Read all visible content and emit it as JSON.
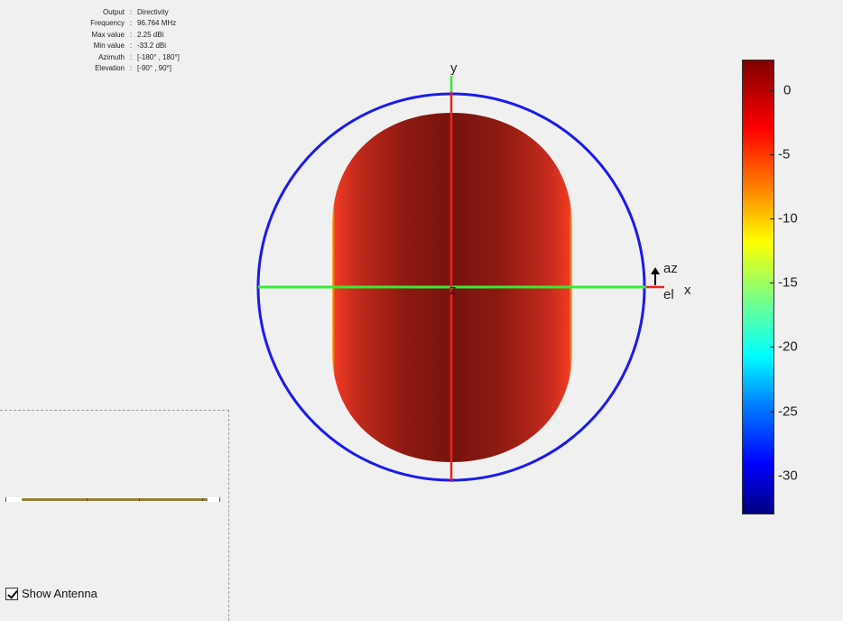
{
  "info": {
    "rows": [
      {
        "label": "Output",
        "value": "Directivity"
      },
      {
        "label": "Frequency",
        "value": "96.764 MHz"
      },
      {
        "label": "Max value",
        "value": "2.25 dBi"
      },
      {
        "label": "Min value",
        "value": "-33.2 dBi"
      },
      {
        "label": "Azimuth",
        "value": "[-180° , 180°]"
      },
      {
        "label": "Elevation",
        "value": "[-90° , 90°]"
      }
    ],
    "separator": ":"
  },
  "axes": {
    "x": "x",
    "y": "y",
    "z": "z",
    "az": "az",
    "el": "el"
  },
  "colorbar": {
    "ticks": [
      "0",
      "-5",
      "-10",
      "-15",
      "-20",
      "-25",
      "-30"
    ],
    "range": [
      -33.2,
      2.25
    ]
  },
  "controls": {
    "show_antenna_label": "Show Antenna",
    "show_antenna_checked": true
  },
  "colors": {
    "sphere": "#0000ff",
    "x_axis": "#00ee00",
    "y_axis": "#ff0000",
    "pattern_dark": "#7a1510",
    "pattern_edge": "#ee3322"
  }
}
